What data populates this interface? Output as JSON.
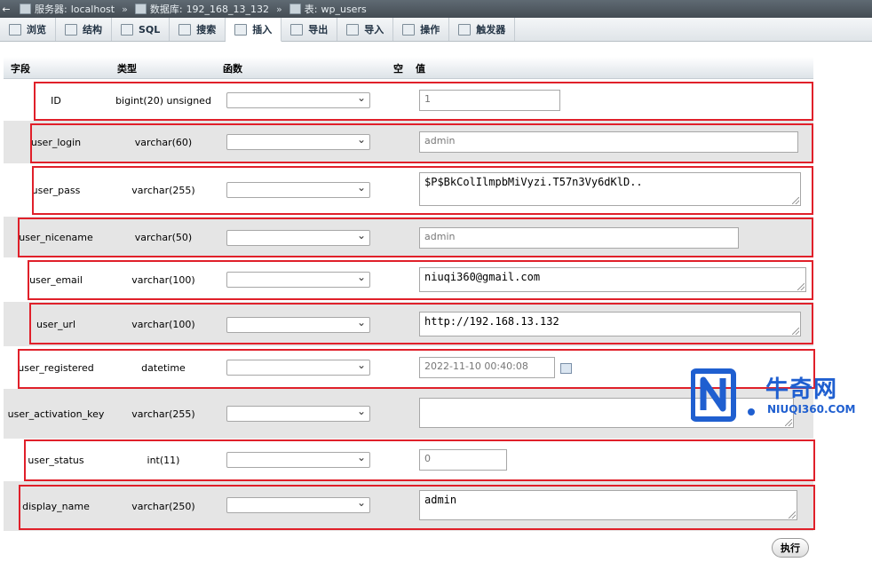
{
  "breadcrumb": {
    "back": "←",
    "server_label": "服务器:",
    "server_value": "localhost",
    "sep1": "»",
    "db_label": "数据库:",
    "db_value": "192_168_13_132",
    "sep2": "»",
    "table_label": "表:",
    "table_value": "wp_users"
  },
  "tabs": [
    {
      "label": "浏览",
      "icon": "browse-icon"
    },
    {
      "label": "结构",
      "icon": "structure-icon"
    },
    {
      "label": "SQL",
      "icon": "sql-icon"
    },
    {
      "label": "搜索",
      "icon": "search-icon"
    },
    {
      "label": "插入",
      "icon": "insert-icon",
      "active": true
    },
    {
      "label": "导出",
      "icon": "export-icon"
    },
    {
      "label": "导入",
      "icon": "import-icon"
    },
    {
      "label": "操作",
      "icon": "wrench-icon"
    },
    {
      "label": "触发器",
      "icon": "trigger-icon"
    }
  ],
  "columns": {
    "field": "字段",
    "type": "类型",
    "function": "函数",
    "null": "空",
    "value": "值"
  },
  "rows": [
    {
      "field": "ID",
      "type": "bigint(20) unsigned",
      "value": "1"
    },
    {
      "field": "user_login",
      "type": "varchar(60)",
      "value": "admin"
    },
    {
      "field": "user_pass",
      "type": "varchar(255)",
      "value": "$P$BkColIlmpbMiVyzi.T57n3Vy6dKlD.."
    },
    {
      "field": "user_nicename",
      "type": "varchar(50)",
      "value": "admin"
    },
    {
      "field": "user_email",
      "type": "varchar(100)",
      "value": "niuqi360@gmail.com"
    },
    {
      "field": "user_url",
      "type": "varchar(100)",
      "value": "http://192.168.13.132"
    },
    {
      "field": "user_registered",
      "type": "datetime",
      "value": "2022-11-10 00:40:08"
    },
    {
      "field": "user_activation_key",
      "type": "varchar(255)",
      "value": ""
    },
    {
      "field": "user_status",
      "type": "int(11)",
      "value": "0"
    },
    {
      "field": "display_name",
      "type": "varchar(250)",
      "value": "admin"
    }
  ],
  "execute_label": "执行",
  "watermark": {
    "cn": "牛奇网",
    "en": "NIUQI360.COM"
  },
  "colors": {
    "highlight": "#e0202a",
    "row_alt": "#e5e5e5",
    "watermark": "#1f5fd0"
  }
}
